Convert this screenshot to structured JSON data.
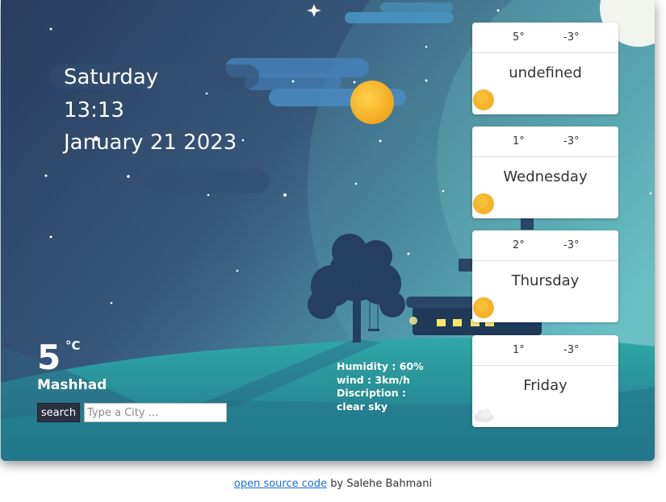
{
  "current": {
    "day": "Saturday",
    "time": "13:13",
    "date": "January 21 2023",
    "temperature": "5",
    "unit": "°C",
    "city": "Mashhad"
  },
  "search": {
    "button_label": "search",
    "placeholder": "Type a City ..."
  },
  "details": {
    "humidity": "Humidity : 60%",
    "wind": "wind : 3km/h",
    "description_label": "Discription :",
    "description": "clear sky"
  },
  "forecast": [
    {
      "hi": "5°",
      "lo": "-3°",
      "day": "undefined",
      "icon": "sun-icon"
    },
    {
      "hi": "1°",
      "lo": "-3°",
      "day": "Wednesday",
      "icon": "sun-icon"
    },
    {
      "hi": "2°",
      "lo": "-3°",
      "day": "Thursday",
      "icon": "sun-icon"
    },
    {
      "hi": "1°",
      "lo": "-3°",
      "day": "Friday",
      "icon": "cloud-icon"
    }
  ],
  "footer": {
    "link_text": "open source code",
    "by_text": " by Salehe Bahmani"
  },
  "colors": {
    "sky_top": "#2c4466",
    "sky_mid": "#3e6c8a",
    "sky_right": "#5fb6bf",
    "hill": "#2f9a9e",
    "sun": "#f5b82e",
    "window_light": "#f9e66a",
    "link": "#1a6fd6"
  }
}
